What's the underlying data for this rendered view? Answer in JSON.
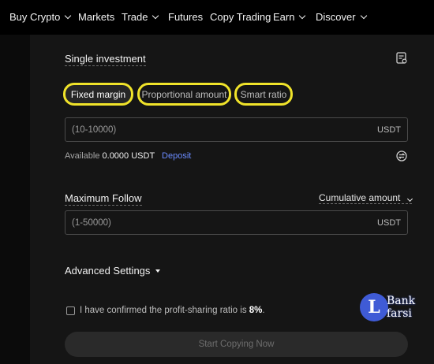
{
  "nav": {
    "items": [
      {
        "label": "Buy Crypto",
        "has_dropdown": true
      },
      {
        "label": "Markets",
        "has_dropdown": false
      },
      {
        "label": "Trade",
        "has_dropdown": true
      },
      {
        "label": "Futures",
        "has_dropdown": false
      },
      {
        "label": "Copy Trading",
        "has_dropdown": false
      },
      {
        "label": "Earn",
        "has_dropdown": true
      },
      {
        "label": "Discover",
        "has_dropdown": true
      }
    ]
  },
  "investment": {
    "title": "Single investment",
    "modes": [
      "Fixed margin",
      "Proportional amount",
      "Smart ratio"
    ],
    "selected_mode": "Fixed margin",
    "amount_placeholder": "(10-10000)",
    "amount_value": "",
    "amount_unit": "USDT",
    "available_label": "Available",
    "available_value": "0.0000 USDT",
    "deposit_label": "Deposit"
  },
  "max_follow": {
    "title": "Maximum Follow",
    "dropdown_label": "Cumulative amount",
    "placeholder": "(1-50000)",
    "value": "",
    "unit": "USDT"
  },
  "advanced_settings_label": "Advanced Settings",
  "confirm": {
    "text": "I have confirmed the profit-sharing ratio is",
    "ratio": "8%",
    "end": ".",
    "checked": false
  },
  "start_button_label": "Start Copying Now",
  "watermark": {
    "logo_letter": "L",
    "line1": "Bank",
    "line2": "farsi"
  },
  "colors": {
    "highlight": "#f0e32a",
    "accent_link": "#6b8cff",
    "background": "#151515",
    "nav_background": "#000000"
  },
  "icons": {
    "title_action": "document-icon",
    "convert": "swap-icon"
  }
}
